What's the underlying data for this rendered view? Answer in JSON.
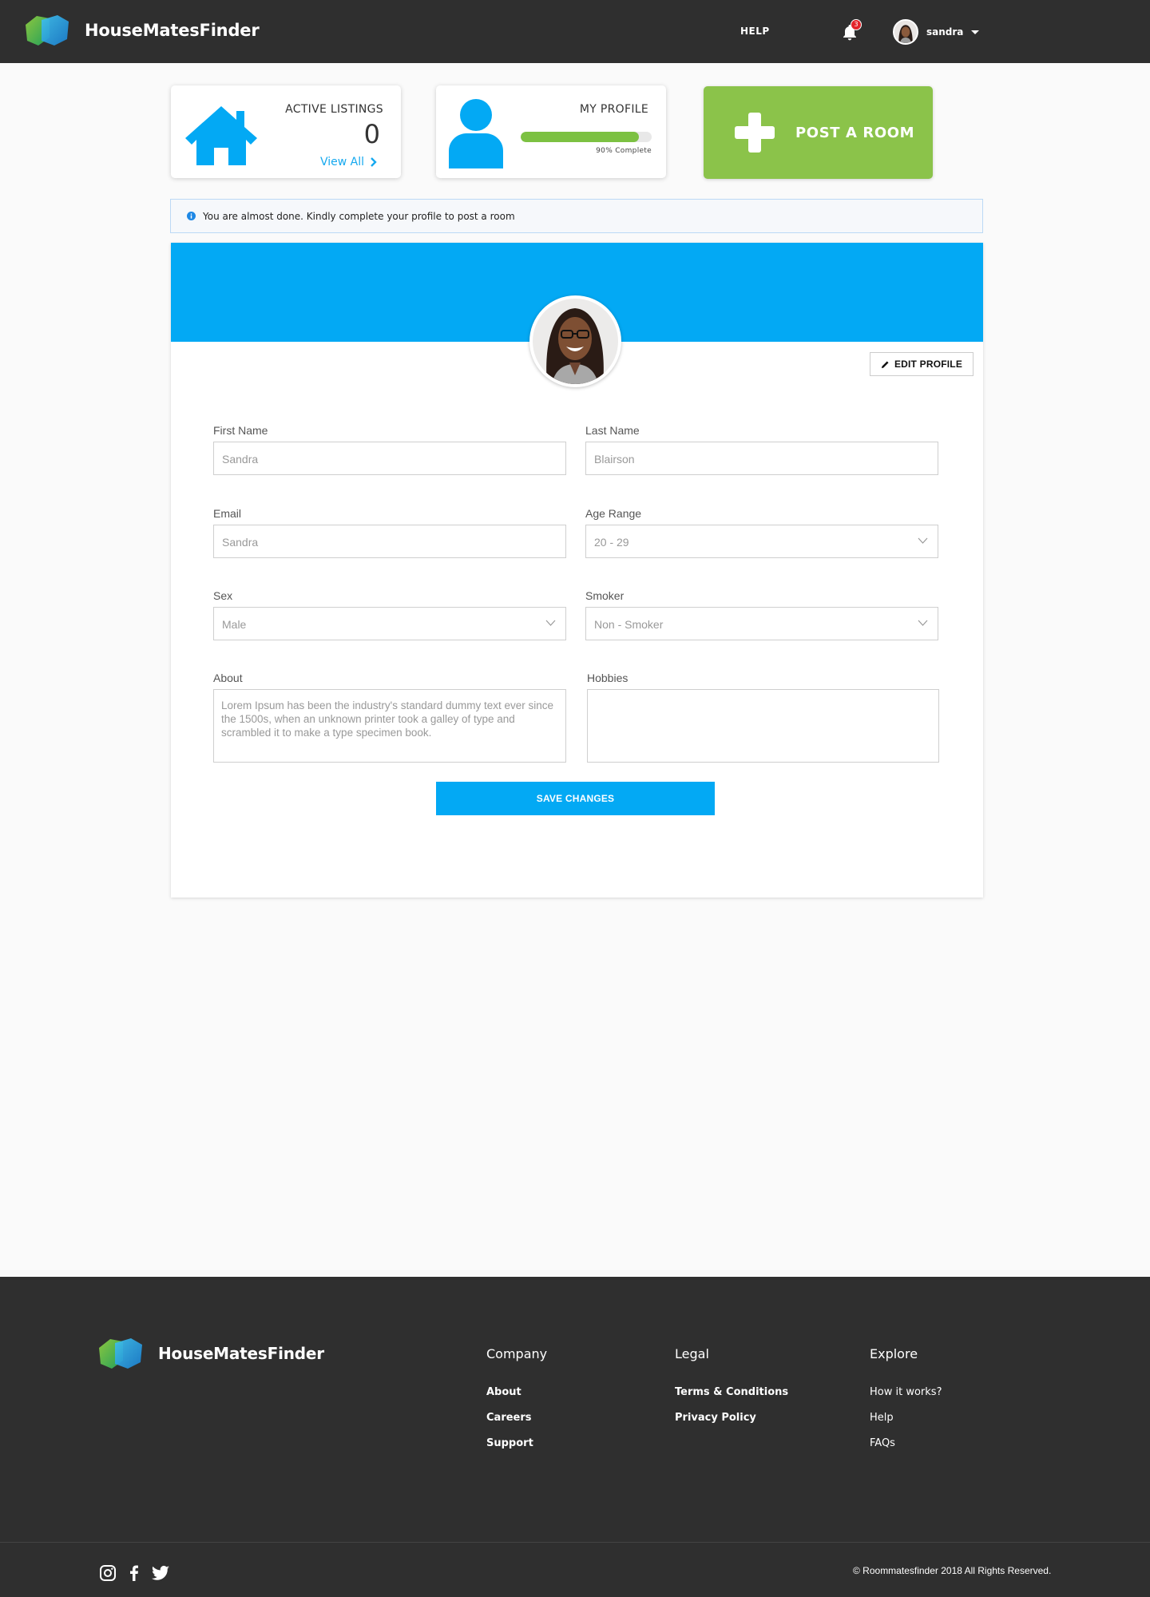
{
  "header": {
    "brand": "HouseMatesFinder",
    "help": "HELP",
    "notification_count": "3",
    "username": "sandra"
  },
  "cards": {
    "listings": {
      "title": "ACTIVE LISTINGS",
      "count": "0",
      "link": "View All"
    },
    "profile": {
      "title": "MY PROFILE",
      "progress_text": "90% Complete",
      "progress": 0.9
    },
    "post_room": "POST A ROOM"
  },
  "alert": {
    "text": "You are almost done. Kindly complete your profile to post a room"
  },
  "profile": {
    "edit_button": "EDIT PROFILE",
    "first_name": {
      "label": "First Name",
      "value": "Sandra"
    },
    "last_name": {
      "label": "Last Name",
      "value": "Blairson"
    },
    "email": {
      "label": "Email",
      "value": "Sandra"
    },
    "age_range": {
      "label": "Age Range",
      "value": "20 - 29"
    },
    "sex": {
      "label": "Sex",
      "value": "Male"
    },
    "smoker": {
      "label": "Smoker",
      "value": "Non - Smoker"
    },
    "about": {
      "label": "About",
      "value": "Lorem Ipsum has been the industry's standard dummy text ever since the 1500s, when an unknown printer took a galley of type and scrambled it to make a type specimen book."
    },
    "hobbies": {
      "label": "Hobbies",
      "value": ""
    },
    "save_button": "SAVE CHANGES"
  },
  "footer": {
    "brand": "HouseMatesFinder",
    "company": {
      "title": "Company",
      "links": [
        "About",
        "Careers",
        "Support"
      ]
    },
    "legal": {
      "title": "Legal",
      "links": [
        "Terms & Conditions",
        "Privacy Policy"
      ]
    },
    "explore": {
      "title": "Explore",
      "links": [
        "How it works?",
        "Help",
        "FAQs"
      ]
    },
    "copyright": "© Roommatesfinder 2018 All Rights Reserved.",
    "social": [
      "instagram-icon",
      "facebook-icon",
      "twitter-icon"
    ]
  },
  "colors": {
    "header_bg": "#2f2f2f",
    "accent_blue": "#03a9f4",
    "accent_green": "#8bc34a",
    "progress_green": "#7cc142",
    "badge_red": "#e3242b"
  }
}
